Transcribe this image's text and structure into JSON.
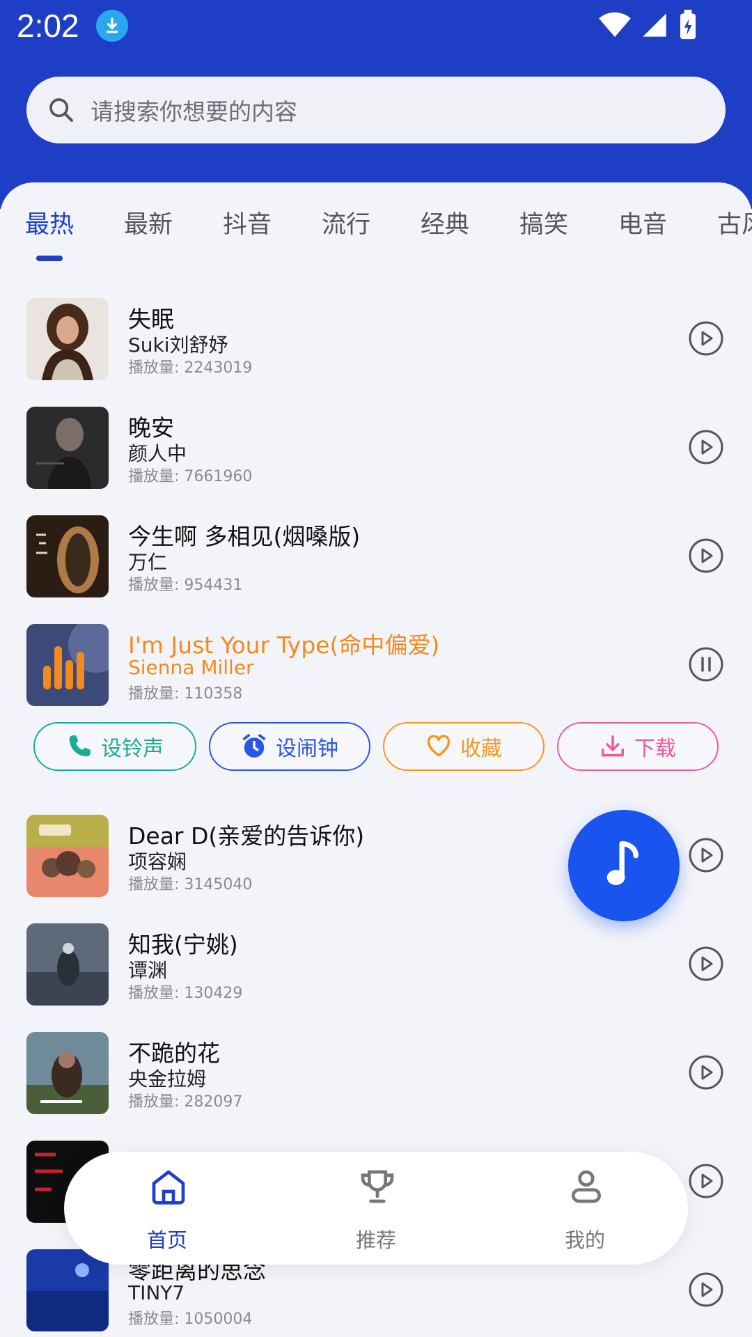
{
  "status_bar": {
    "time": "2:02"
  },
  "search": {
    "placeholder": "请搜索你想要的内容"
  },
  "tabs": [
    "最热",
    "最新",
    "抖音",
    "流行",
    "经典",
    "搞笑",
    "电音",
    "古风"
  ],
  "songs": [
    {
      "title": "失眠",
      "artist": "Suki刘舒妤",
      "plays": "播放量: 2243019",
      "state": "play"
    },
    {
      "title": "晚安",
      "artist": "颜人中",
      "plays": "播放量: 7661960",
      "state": "play"
    },
    {
      "title": "今生啊 多相见(烟嗓版)",
      "artist": "万仁",
      "plays": "播放量: 954431",
      "state": "play"
    },
    {
      "title": "I'm Just Your Type(命中偏爱)",
      "artist": "Sienna Miller",
      "plays": "播放量: 110358",
      "state": "pause"
    },
    {
      "title": "Dear D(亲爱的告诉你)",
      "artist": "项容娴",
      "plays": "播放量: 3145040",
      "state": "play"
    },
    {
      "title": "知我(宁姚)",
      "artist": "谭渊",
      "plays": "播放量: 130429",
      "state": "play"
    },
    {
      "title": "不跪的花",
      "artist": "央金拉姆",
      "plays": "播放量: 282097",
      "state": "play"
    },
    {
      "title": "",
      "artist": "",
      "plays": "",
      "state": "play"
    },
    {
      "title": "零距离的思念",
      "artist": "TINY7",
      "plays": "播放量: 1050004",
      "state": "play"
    }
  ],
  "actions": {
    "ringtone": "设铃声",
    "alarm": "设闹钟",
    "favorite": "收藏",
    "download": "下载"
  },
  "colors": {
    "primary": "#1e3ec6",
    "playing": "#f4891e",
    "ringtone": "#1aab98",
    "alarm": "#2a56e8",
    "favorite": "#f4981e",
    "download": "#ef5a9c"
  },
  "bottom_nav": [
    {
      "label": "首页",
      "icon": "home-icon",
      "active": true
    },
    {
      "label": "推荐",
      "icon": "trophy-icon",
      "active": false
    },
    {
      "label": "我的",
      "icon": "profile-icon",
      "active": false
    }
  ]
}
